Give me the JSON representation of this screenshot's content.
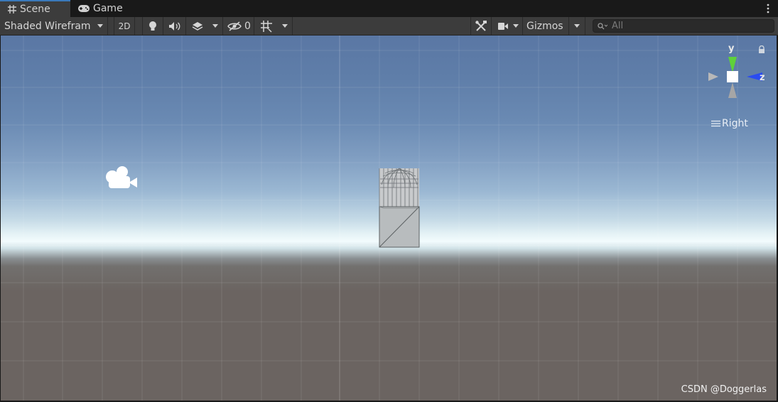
{
  "tabs": [
    {
      "label": "Scene",
      "icon": "grid-icon",
      "active": true
    },
    {
      "label": "Game",
      "icon": "gamepad-icon",
      "active": false
    }
  ],
  "toolbar": {
    "draw_mode": "Shaded Wirefram",
    "mode_2d": "2D",
    "hidden_count": "0",
    "gizmos_label": "Gizmos",
    "search_placeholder": "All"
  },
  "orientation": {
    "y_axis": "y",
    "z_axis": "z",
    "view_label": "Right"
  },
  "watermark": "CSDN @Doggerlas",
  "colors": {
    "accent": "#3a79bb",
    "y_axis": "#5fd13a",
    "z_axis": "#2a4cf0",
    "panel": "#3c3c3c"
  }
}
